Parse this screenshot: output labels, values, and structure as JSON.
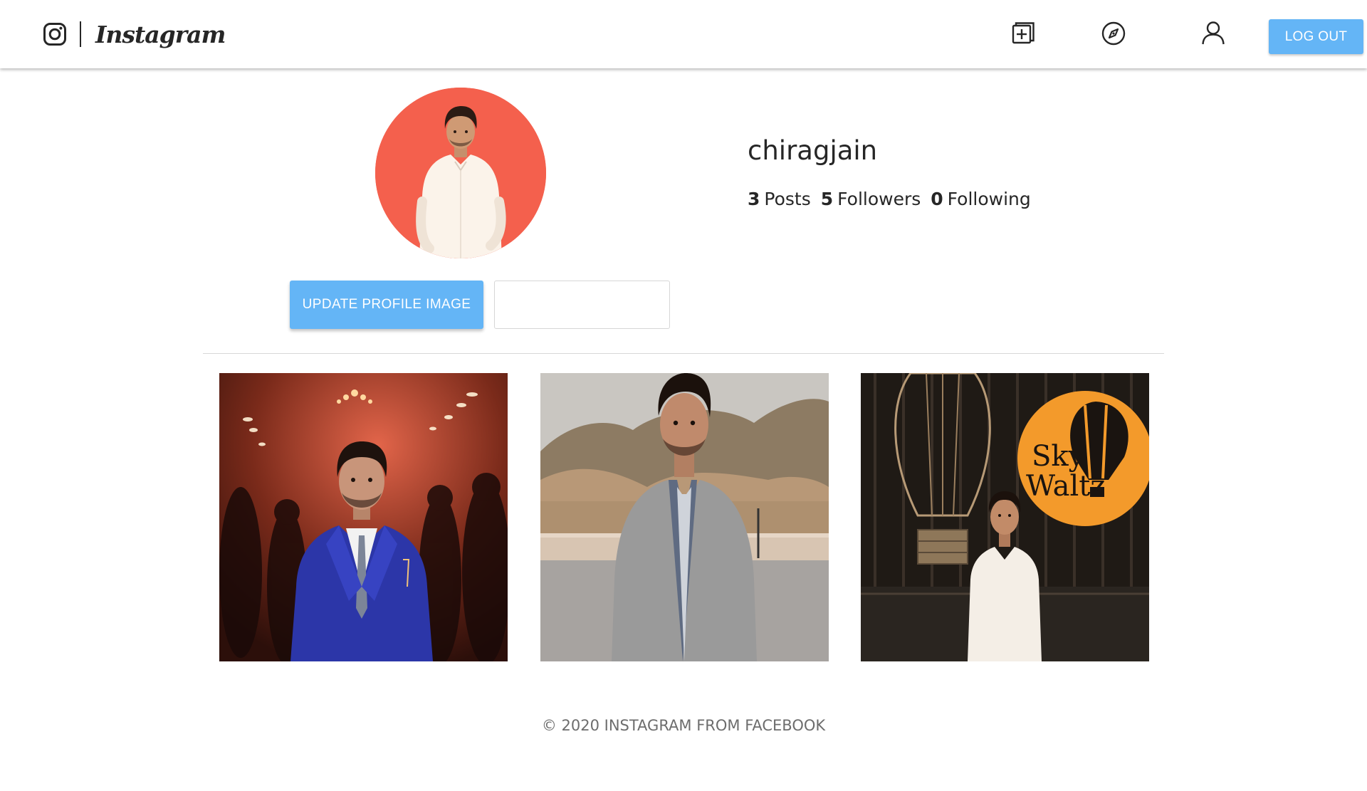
{
  "navbar": {
    "brand_name": "Instagram",
    "icons": [
      "instagram-glyph-icon",
      "create-post-icon",
      "explore-compass-icon",
      "profile-user-icon"
    ],
    "logout_label": "LOG OUT",
    "accent_color": "#64b5f6"
  },
  "profile": {
    "username": "chiragjain",
    "stats": [
      {
        "count": "3",
        "label": "Posts"
      },
      {
        "count": "5",
        "label": "Followers"
      },
      {
        "count": "0",
        "label": "Following"
      }
    ],
    "avatar_bg_color": "#f4604d",
    "update_button_label": "UPDATE PROFILE IMAGE",
    "file_input_value": ""
  },
  "posts": [
    {
      "id": "post-1",
      "theme": "wedding-reception-blue-suit"
    },
    {
      "id": "post-2",
      "theme": "hillside-grey-jacket"
    },
    {
      "id": "post-3",
      "theme": "sky-waltz-balloon-sign",
      "sign_text": [
        "Sky",
        "Waltz"
      ]
    }
  ],
  "footer": {
    "text": "© 2020 INSTAGRAM FROM FACEBOOK"
  }
}
